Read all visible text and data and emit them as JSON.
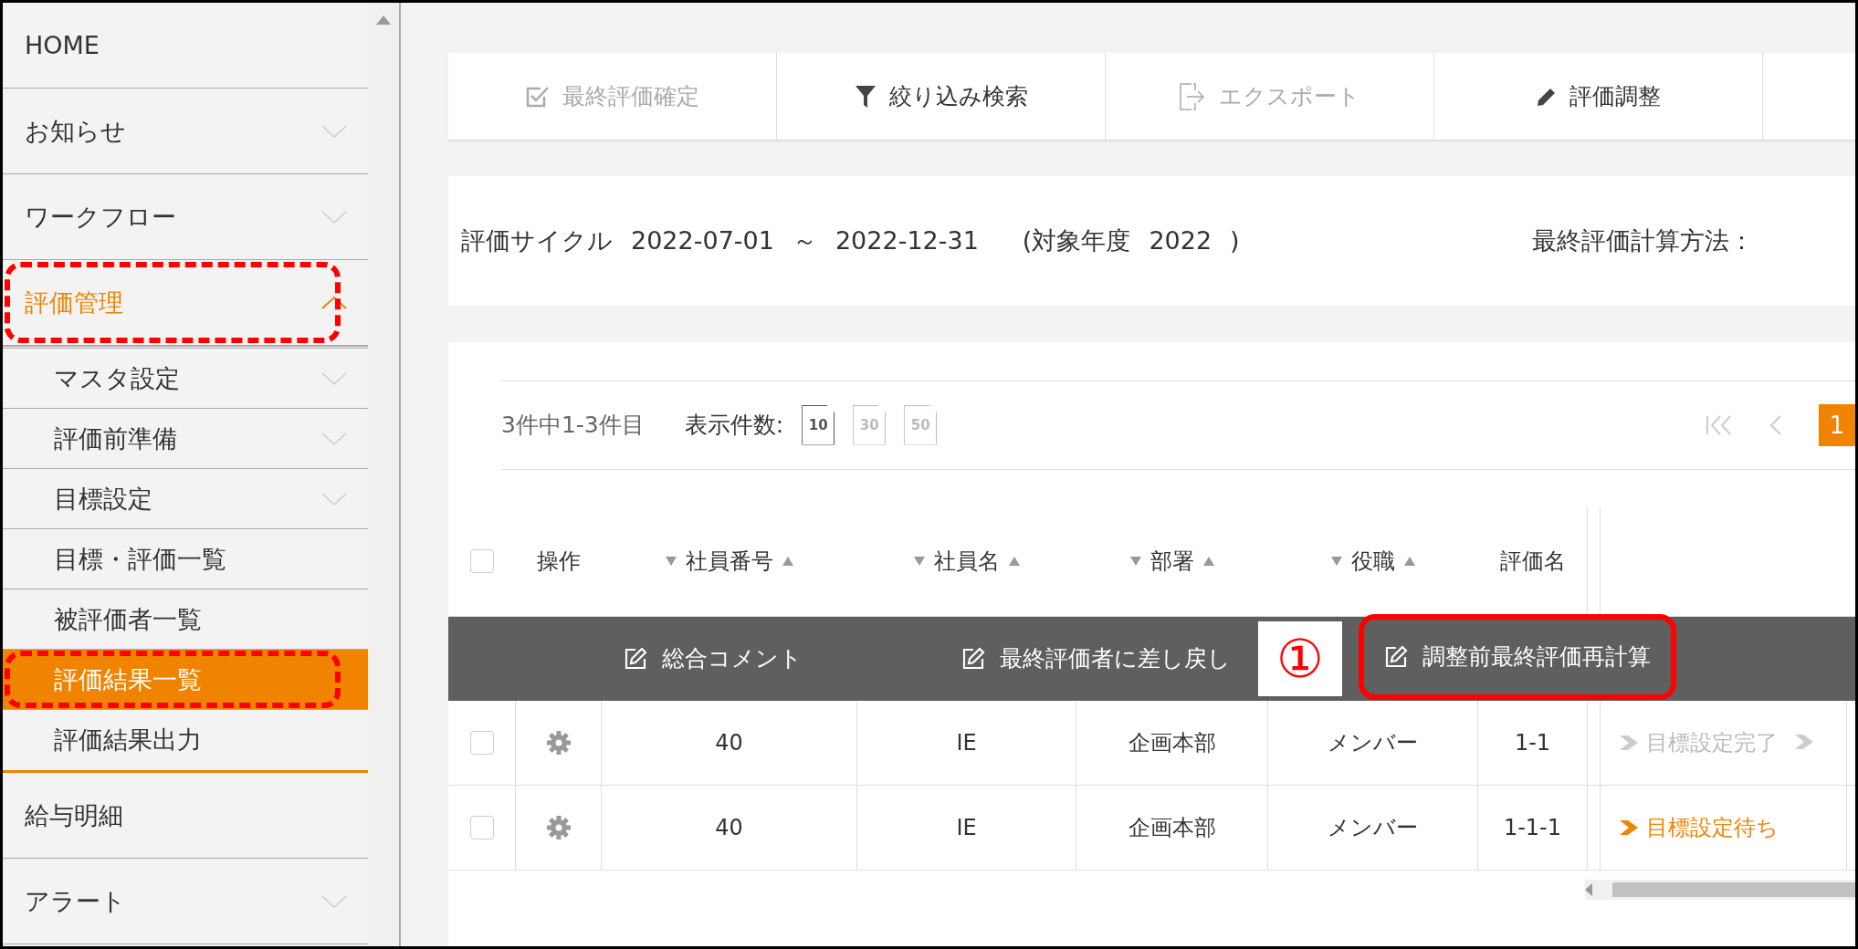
{
  "sidebar": {
    "items": [
      {
        "label": "HOME",
        "kind": "link",
        "selected": false,
        "annotated": false
      },
      {
        "label": "お知らせ",
        "kind": "group",
        "expanded": false,
        "selected": false,
        "annotated": false
      },
      {
        "label": "ワークフロー",
        "kind": "group",
        "expanded": false,
        "selected": false,
        "annotated": false
      },
      {
        "label": "評価管理",
        "kind": "group",
        "expanded": true,
        "selected": false,
        "annotated": true,
        "children": [
          {
            "label": "マスタ設定",
            "kind": "group",
            "expanded": false,
            "selected": false,
            "annotated": false
          },
          {
            "label": "評価前準備",
            "kind": "group",
            "expanded": false,
            "selected": false,
            "annotated": false
          },
          {
            "label": "目標設定",
            "kind": "group",
            "expanded": false,
            "selected": false,
            "annotated": false
          },
          {
            "label": "目標・評価一覧",
            "kind": "link",
            "selected": false,
            "annotated": false
          },
          {
            "label": "被評価者一覧",
            "kind": "link",
            "selected": false,
            "annotated": false
          },
          {
            "label": "評価結果一覧",
            "kind": "link",
            "selected": true,
            "annotated": true
          },
          {
            "label": "評価結果出力",
            "kind": "link",
            "selected": false,
            "annotated": false
          }
        ]
      },
      {
        "label": "給与明細",
        "kind": "link",
        "selected": false,
        "annotated": false
      },
      {
        "label": "アラート",
        "kind": "group",
        "expanded": false,
        "selected": false,
        "annotated": false
      }
    ]
  },
  "toolbar": {
    "buttons": [
      {
        "label": "最終評価確定",
        "kind": "check",
        "disabled": true
      },
      {
        "label": "絞り込み検索",
        "kind": "filter",
        "disabled": false
      },
      {
        "label": "エクスポート",
        "kind": "export",
        "disabled": true
      },
      {
        "label": "評価調整",
        "kind": "pencil",
        "disabled": false
      }
    ]
  },
  "cycle": {
    "label": "評価サイクル",
    "start": "2022-07-01",
    "separator": "～",
    "end": "2022-12-31",
    "year_label": "(対象年度",
    "year": "2022",
    "year_close": ")",
    "method_label": "最終評価計算方法："
  },
  "pagination": {
    "summary": "3件中1-3件目",
    "page_size_label": "表示件数:",
    "page_sizes": [
      {
        "label": "10",
        "selected": true
      },
      {
        "label": "30",
        "selected": false
      },
      {
        "label": "50",
        "selected": false
      }
    ],
    "pages": [
      {
        "label": "1",
        "selected": true
      }
    ]
  },
  "table": {
    "columns": [
      {
        "kind": "checkbox",
        "checked": false
      },
      {
        "kind": "text",
        "label": "操作"
      },
      {
        "kind": "sortable",
        "label": "社員番号"
      },
      {
        "kind": "sortable",
        "label": "社員名"
      },
      {
        "kind": "sortable",
        "label": "部署"
      },
      {
        "kind": "sortable",
        "label": "役職"
      },
      {
        "kind": "text",
        "label": "評価名"
      }
    ],
    "rows": [
      {
        "checked": false,
        "cells": {
          "employee_no": "40",
          "name": "IE",
          "dept": "企画本部",
          "role": "メンバー",
          "evaluation": "1-1"
        },
        "status": {
          "kind": "done",
          "label": "目標設定完了"
        }
      },
      {
        "checked": false,
        "cells": {
          "employee_no": "40",
          "name": "IE",
          "dept": "企画本部",
          "role": "メンバー",
          "evaluation": "1-1-1"
        },
        "status": {
          "kind": "pending",
          "label": "目標設定待ち"
        }
      }
    ],
    "action_bar": {
      "actions": [
        {
          "label": "総合コメント",
          "annotated": false
        },
        {
          "label": "最終評価者に差し戻し",
          "annotated": false
        },
        {
          "label": "調整前最終評価再計算",
          "annotated": true,
          "callout": "①"
        }
      ]
    }
  }
}
